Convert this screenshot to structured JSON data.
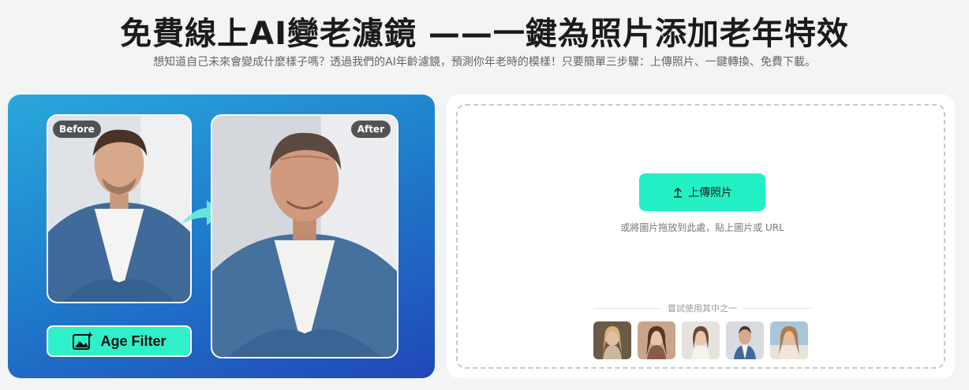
{
  "header": {
    "title": "免費線上AI變老濾鏡 ——一鍵為照片添加老年特效",
    "subtitle": "想知道自己未來會變成什麼樣子嗎？透過我們的AI年齡濾鏡，預測你年老時的模樣！只要簡單三步驟：上傳照片、一鍵轉換、免費下載。"
  },
  "showcase": {
    "before_label": "Before",
    "after_label": "After",
    "filter_label": "Age Filter",
    "icons": [
      "image-sparkle-icon",
      "arrow-right-icon"
    ]
  },
  "upload": {
    "button_label": "上傳照片",
    "button_icon": "upload-arrow-icon",
    "drop_hint": "或將圖片拖放到此處，貼上圖片或 URL",
    "try_label": "嘗試使用其中之一",
    "samples": [
      {
        "name": "sample-photo-1"
      },
      {
        "name": "sample-photo-2"
      },
      {
        "name": "sample-photo-3"
      },
      {
        "name": "sample-photo-4"
      },
      {
        "name": "sample-photo-5"
      }
    ]
  },
  "colors": {
    "accent": "#22f0c4",
    "panel_gradient_top": "#2aa8dc",
    "panel_gradient_bottom": "#2048b8",
    "page_bg": "#f3f4f6"
  }
}
